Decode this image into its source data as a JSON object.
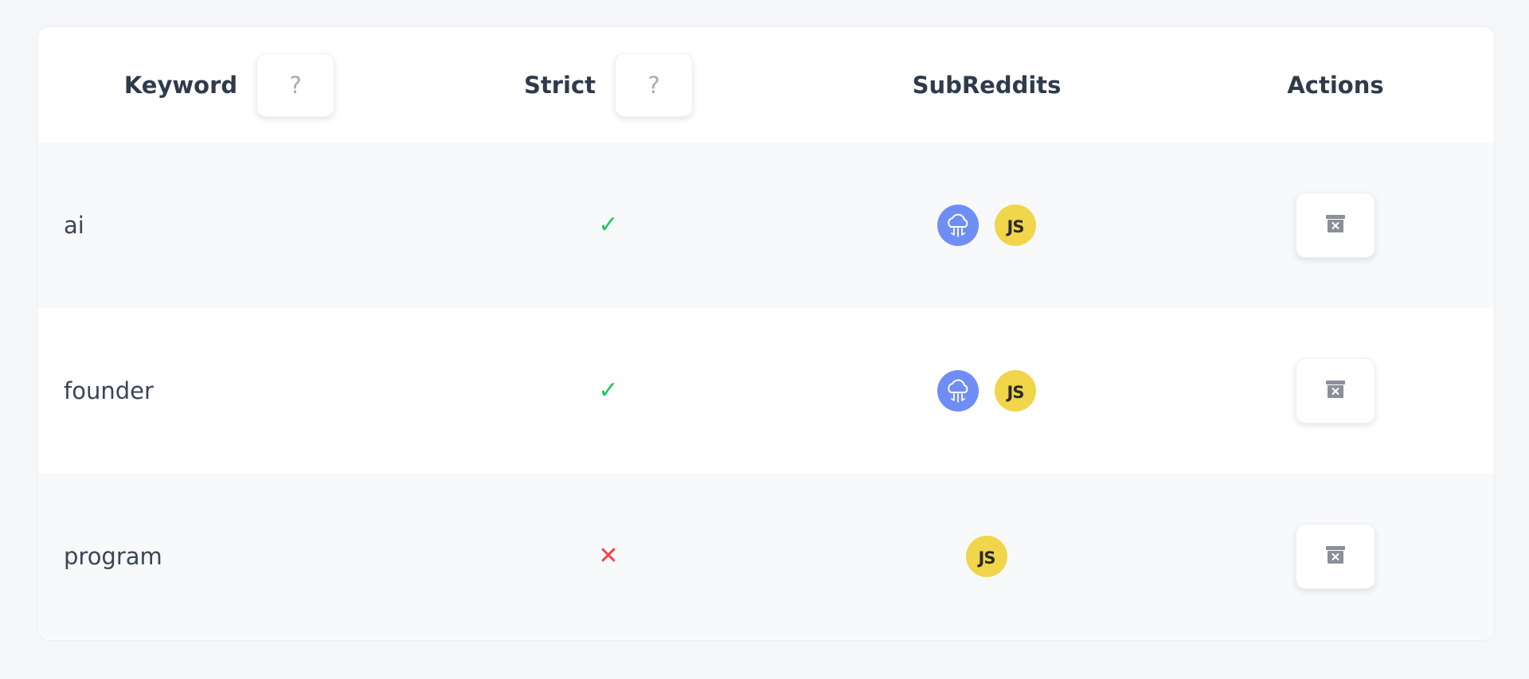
{
  "table": {
    "headers": {
      "keyword": "Keyword",
      "strict": "Strict",
      "subreddits": "SubReddits",
      "actions": "Actions"
    },
    "help_label": "?",
    "rows": [
      {
        "keyword": "ai",
        "strict": "✓",
        "strict_on": true,
        "subreddits": [
          "cloud-subreddit-icon",
          "javascript-subreddit-icon"
        ]
      },
      {
        "keyword": "founder",
        "strict": "✓",
        "strict_on": true,
        "subreddits": [
          "cloud-subreddit-icon",
          "javascript-subreddit-icon"
        ]
      },
      {
        "keyword": "program",
        "strict": "✕",
        "strict_on": false,
        "subreddits": [
          "javascript-subreddit-icon"
        ]
      }
    ],
    "js_icon_label": "JS"
  },
  "colors": {
    "check": "#22c55e",
    "cross": "#ef4444",
    "cloud_icon_bg": "#6f8ef5",
    "js_icon_bg": "#f1d54a",
    "delete_icon": "#8a8f98"
  }
}
